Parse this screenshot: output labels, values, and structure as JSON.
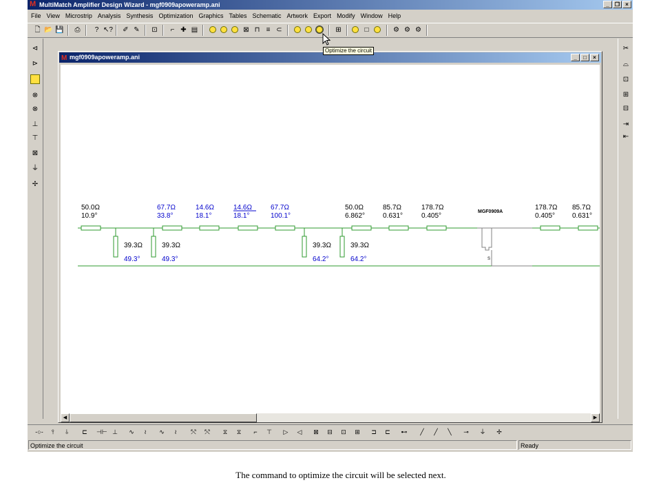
{
  "app": {
    "title": "MultiMatch Amplifier Design Wizard - mgf0909apoweramp.ani",
    "window_buttons": [
      "_",
      "̅",
      "×"
    ]
  },
  "menu": [
    "File",
    "View",
    "Microstrip",
    "Analysis",
    "Synthesis",
    "Optimization",
    "Graphics",
    "Tables",
    "Schematic",
    "Artwork",
    "Export",
    "Modify",
    "Window",
    "Help"
  ],
  "tooltip": "Optimize the circuit",
  "document": {
    "title": "mgf0909apoweramp.ani"
  },
  "schematic": {
    "device_label": "MGF0909A",
    "source_label": "S",
    "series_elements": [
      {
        "impedance": "50.0Ω",
        "length": "10.9°",
        "color": "#000000"
      },
      {
        "impedance": "67.7Ω",
        "length": "33.8°",
        "color": "#0000cc"
      },
      {
        "impedance": "14.6Ω",
        "length": "18.1°",
        "color": "#0000cc"
      },
      {
        "impedance": "14.6Ω",
        "length": "18.1°",
        "color": "#0000cc"
      },
      {
        "impedance": "67.7Ω",
        "length": "100.1°",
        "color": "#0000cc"
      },
      {
        "impedance": "50.0Ω",
        "length": "6.862°",
        "color": "#000000"
      },
      {
        "impedance": "85.7Ω",
        "length": "0.631°",
        "color": "#000000"
      },
      {
        "impedance": "178.7Ω",
        "length": "0.405°",
        "color": "#000000"
      },
      {
        "impedance": "178.7Ω",
        "length": "0.405°",
        "color": "#000000"
      },
      {
        "impedance": "85.7Ω",
        "length": "0.631°",
        "color": "#000000"
      }
    ],
    "shunt_stubs": [
      {
        "impedance": "39.3Ω",
        "length": "49.3°"
      },
      {
        "impedance": "39.3Ω",
        "length": "49.3°"
      },
      {
        "impedance": "39.3Ω",
        "length": "64.2°"
      },
      {
        "impedance": "39.3Ω",
        "length": "64.2°"
      }
    ],
    "line_color": "#2e9a2e",
    "blue_text": "#0000cc"
  },
  "status": {
    "message": "Optimize the circuit",
    "state": "Ready"
  },
  "caption": "The command to optimize the circuit will be selected next."
}
